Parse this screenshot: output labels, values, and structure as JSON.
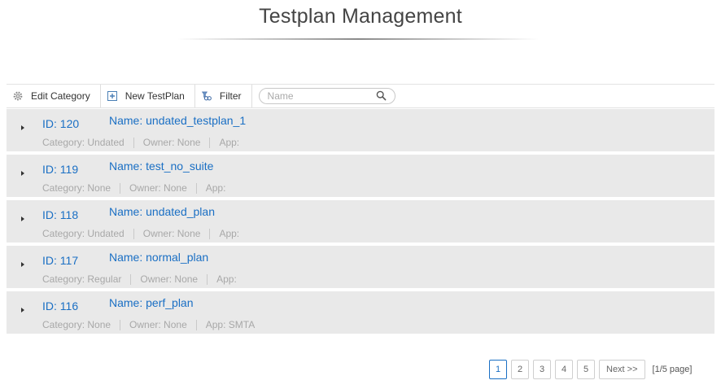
{
  "header": {
    "title": "Testplan Management"
  },
  "toolbar": {
    "edit_category": "Edit Category",
    "new_testplan": "New TestPlan",
    "filter": "Filter",
    "search_placeholder": "Name"
  },
  "rows": [
    {
      "id": "ID: 120",
      "name": "Name: undated_testplan_1",
      "category": "Category: Undated",
      "owner": "Owner: None",
      "app": "App:"
    },
    {
      "id": "ID: 119",
      "name": "Name: test_no_suite",
      "category": "Category: None",
      "owner": "Owner: None",
      "app": "App:"
    },
    {
      "id": "ID: 118",
      "name": "Name: undated_plan",
      "category": "Category: Undated",
      "owner": "Owner: None",
      "app": "App:"
    },
    {
      "id": "ID: 117",
      "name": "Name: normal_plan",
      "category": "Category: Regular",
      "owner": "Owner: None",
      "app": "App:"
    },
    {
      "id": "ID: 116",
      "name": "Name: perf_plan",
      "category": "Category: None",
      "owner": "Owner: None",
      "app": "App: SMTA"
    }
  ],
  "pagination": {
    "pages": [
      "1",
      "2",
      "3",
      "4",
      "5"
    ],
    "current": "1",
    "next": "Next >>",
    "info": "[1/5 page]"
  },
  "icons": {
    "edit_category": "gear-icon",
    "new_testplan": "plus-box-icon",
    "filter": "filter-icon",
    "search": "search-icon",
    "expand": "caret-right-icon"
  },
  "colors": {
    "link": "#1a6fc4",
    "row_bg": "#e9e9e9",
    "meta_text": "#a8a8a8"
  }
}
